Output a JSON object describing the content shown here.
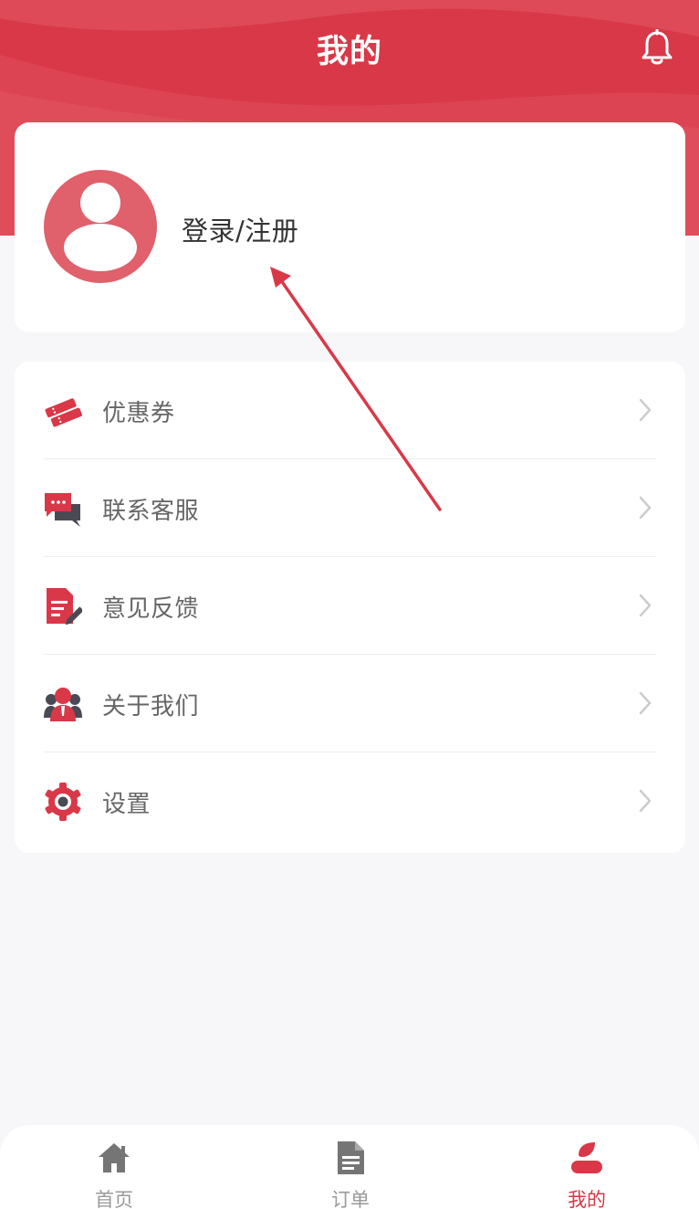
{
  "header": {
    "title": "我的",
    "bell_icon": "bell-icon"
  },
  "profile": {
    "avatar_icon": "user-avatar-icon",
    "login_text": "登录/注册"
  },
  "menu": {
    "items": [
      {
        "label": "优惠券",
        "icon": "coupon-icon"
      },
      {
        "label": "联系客服",
        "icon": "chat-icon"
      },
      {
        "label": "意见反馈",
        "icon": "feedback-icon"
      },
      {
        "label": "关于我们",
        "icon": "about-us-icon"
      },
      {
        "label": "设置",
        "icon": "settings-gear-icon"
      }
    ]
  },
  "tabbar": {
    "tabs": [
      {
        "label": "首页",
        "icon": "home-icon",
        "active": false
      },
      {
        "label": "订单",
        "icon": "document-icon",
        "active": false
      },
      {
        "label": "我的",
        "icon": "user-icon",
        "active": true
      }
    ]
  },
  "colors": {
    "primary": "#d93848",
    "background": "#f7f7f9",
    "text_dark": "#333333",
    "text_gray": "#666666",
    "tab_inactive": "#999999"
  }
}
